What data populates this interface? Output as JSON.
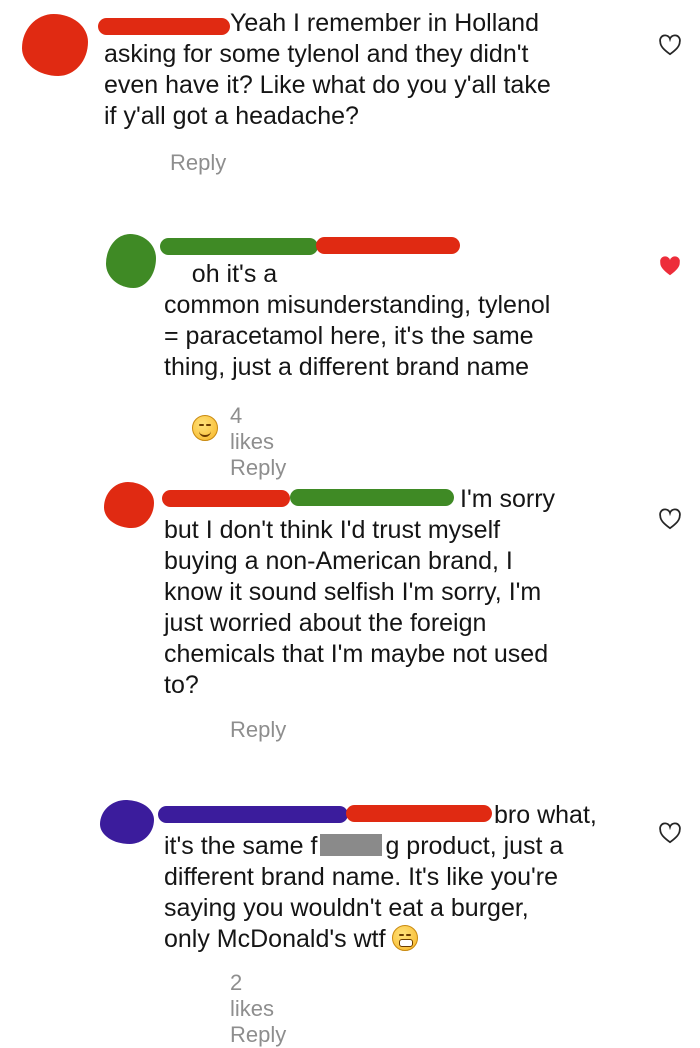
{
  "comments": [
    {
      "text": "Yeah I remember in Holland\nasking for some tylenol and they didn't\neven have it? Like what do you y'all take\nif y'all got a headache?",
      "reply_label": "Reply",
      "liked": false
    },
    {
      "text": "oh it's a\ncommon misunderstanding, tylenol\n= paracetamol here, it's the same\nthing, just a different brand name",
      "likes_label": "4 likes",
      "reply_label": "Reply",
      "liked": true
    },
    {
      "text": "I'm sorry\nbut I don't think I'd trust myself\nbuying a non-American brand, I\nknow it sound selfish I'm sorry, I'm\njust worried about the foreign\nchemicals that I'm maybe not used\nto?",
      "reply_label": "Reply",
      "liked": false
    },
    {
      "text_before": "bro what,\nit's the same f",
      "text_after": "g product, just a\ndifferent brand name. It's like you're\nsaying you wouldn't eat a burger,\nonly McDonald's wtf ",
      "likes_label": "2 likes",
      "reply_label": "Reply",
      "liked": false
    }
  ],
  "colors": {
    "red_scribble": "#e02a12",
    "green_scribble": "#3f8a25",
    "purple_scribble": "#3b1c9c",
    "heart_liked": "#ed2d3a",
    "heart_outline": "#262626",
    "meta_gray": "#8e8e8e"
  },
  "icons": [
    "heart-outline-icon",
    "heart-filled-icon",
    "smiling-emoji-icon",
    "grimacing-emoji-icon"
  ]
}
